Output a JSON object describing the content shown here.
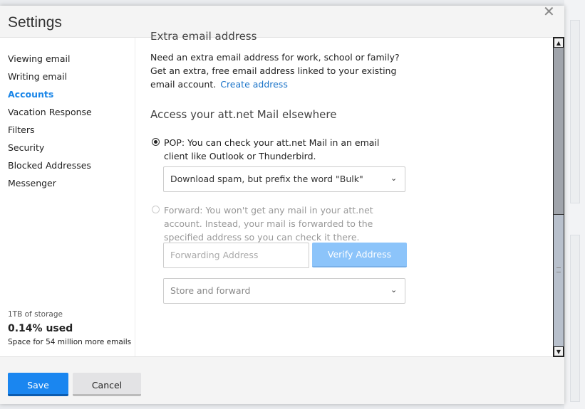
{
  "header": {
    "title": "Settings",
    "close_icon": "close-icon"
  },
  "sidebar": {
    "items": [
      {
        "label": "Viewing email"
      },
      {
        "label": "Writing email"
      },
      {
        "label": "Accounts",
        "active": true
      },
      {
        "label": "Vacation Response"
      },
      {
        "label": "Filters"
      },
      {
        "label": "Security"
      },
      {
        "label": "Blocked Addresses"
      },
      {
        "label": "Messenger"
      }
    ],
    "storage": {
      "total": "1TB of storage",
      "used": "0.14% used",
      "remaining": "Space for 54 million more emails"
    }
  },
  "content": {
    "extra_heading": "Extra email address",
    "extra_text": "Need an extra email address for work, school or family? Get an extra, free email address linked to your existing email account.",
    "create_link": "Create address",
    "access_heading": "Access your att.net Mail elsewhere",
    "pop": {
      "label": "POP: You can check your att.net Mail in an email client like Outlook or Thunderbird.",
      "selected": true,
      "option": "Download spam, but prefix the word \"Bulk\""
    },
    "forward": {
      "label": "Forward: You won't get any mail in your att.net account. Instead, your mail is forwarded to the specified address so you can check it there.",
      "selected": false,
      "placeholder": "Forwarding Address",
      "verify": "Verify Address",
      "option": "Store and forward"
    }
  },
  "footer": {
    "save": "Save",
    "cancel": "Cancel"
  },
  "colors": {
    "accent": "#1a86f0",
    "link": "#1a73c8",
    "verify_disabled": "#8cc4fa"
  }
}
